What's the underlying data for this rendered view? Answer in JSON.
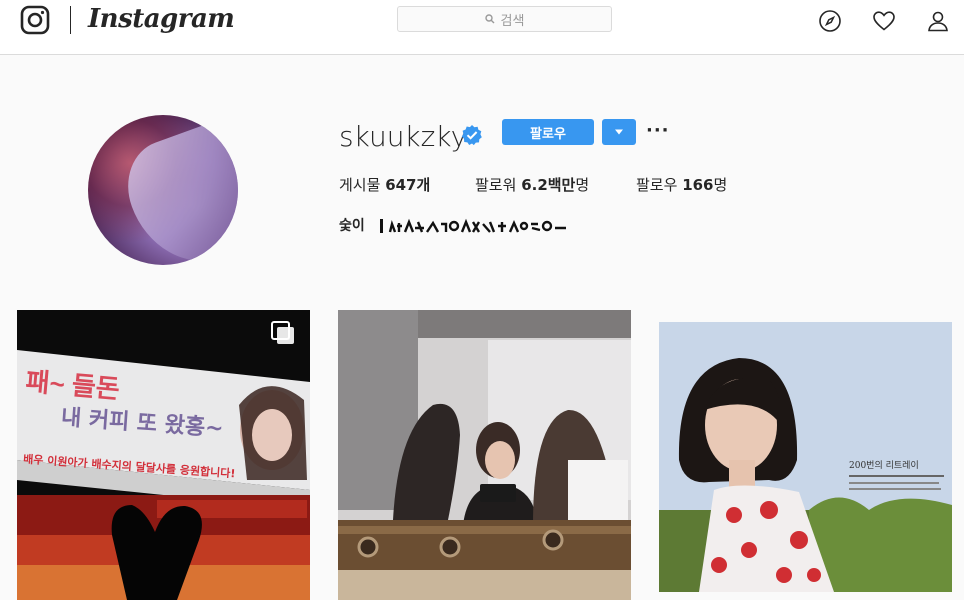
{
  "header": {
    "wordmark": "Instagram",
    "search_placeholder": "검색"
  },
  "profile": {
    "username": "skuukzky",
    "follow_label": "팔로우",
    "more_label": "···",
    "stats": {
      "posts_label": "게시물",
      "posts_value": "647개",
      "followers_label": "팔로워",
      "followers_value": "6.2백만",
      "followers_suffix": "명",
      "following_label": "팔로우",
      "following_value": "166",
      "following_suffix": "명"
    },
    "bio_text": "숯이"
  },
  "posts": {
    "post1_banner_line1": "내 커피 또 왔홍~",
    "post1_banner_line2": "배우 이원아가 배수지의 달달사를 응원합니다!",
    "post3_caption": "200번의 리트레이"
  },
  "colors": {
    "accent": "#3897f0",
    "text": "#262626",
    "border": "#dbdbdb",
    "background": "#fafafa"
  }
}
